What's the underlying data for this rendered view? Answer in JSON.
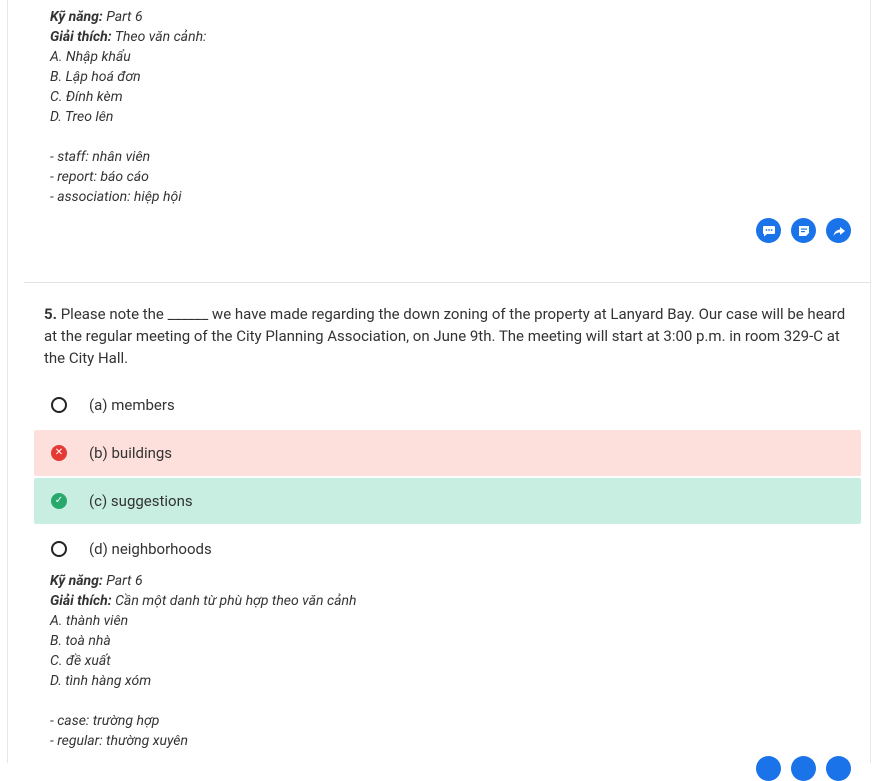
{
  "explanation_prev": {
    "skill_label": "Kỹ năng:",
    "skill_value": "Part 6",
    "explain_label": "Giải thích:",
    "explain_value": "Theo văn cảnh:",
    "options": [
      "A. Nhập khẩu",
      "B. Lập hoá đơn",
      "C. Đính kèm",
      "D. Treo lên"
    ],
    "vocab": [
      "- staff: nhân viên",
      "- report: báo cáo",
      "- association: hiệp hội"
    ]
  },
  "actions": {
    "comment_icon": "comment-icon",
    "note_icon": "note-icon",
    "share_icon": "share-icon",
    "accent_color": "#1a73e8"
  },
  "question": {
    "number": "5.",
    "text": "Please note the ______ we have made regarding the down zoning of the property at Lanyard Bay. Our case will be heard at the regular meeting of the City Planning Association, on June 9th. The meeting will start at 3:00 p.m. in room 329-C at the City Hall."
  },
  "options": [
    {
      "label": "(a) members",
      "state": "none"
    },
    {
      "label": "(b) buildings",
      "state": "wrong"
    },
    {
      "label": "(c) suggestions",
      "state": "correct"
    },
    {
      "label": "(d) neighborhoods",
      "state": "none"
    }
  ],
  "explanation": {
    "skill_label": "Kỹ năng:",
    "skill_value": "Part 6",
    "explain_label": "Giải thích:",
    "explain_value": "Cần một danh từ phù hợp theo văn cảnh",
    "options": [
      "A. thành viên",
      "B. toà nhà",
      "C. đề xuất",
      "D. tình hàng xóm"
    ],
    "vocab": [
      "- case: trường hợp",
      "- regular: thường xuyên"
    ]
  },
  "colors": {
    "wrong_bg": "#fde0db",
    "correct_bg": "#c8eee1",
    "wrong_icon": "#e53935",
    "correct_icon": "#27a96c"
  }
}
